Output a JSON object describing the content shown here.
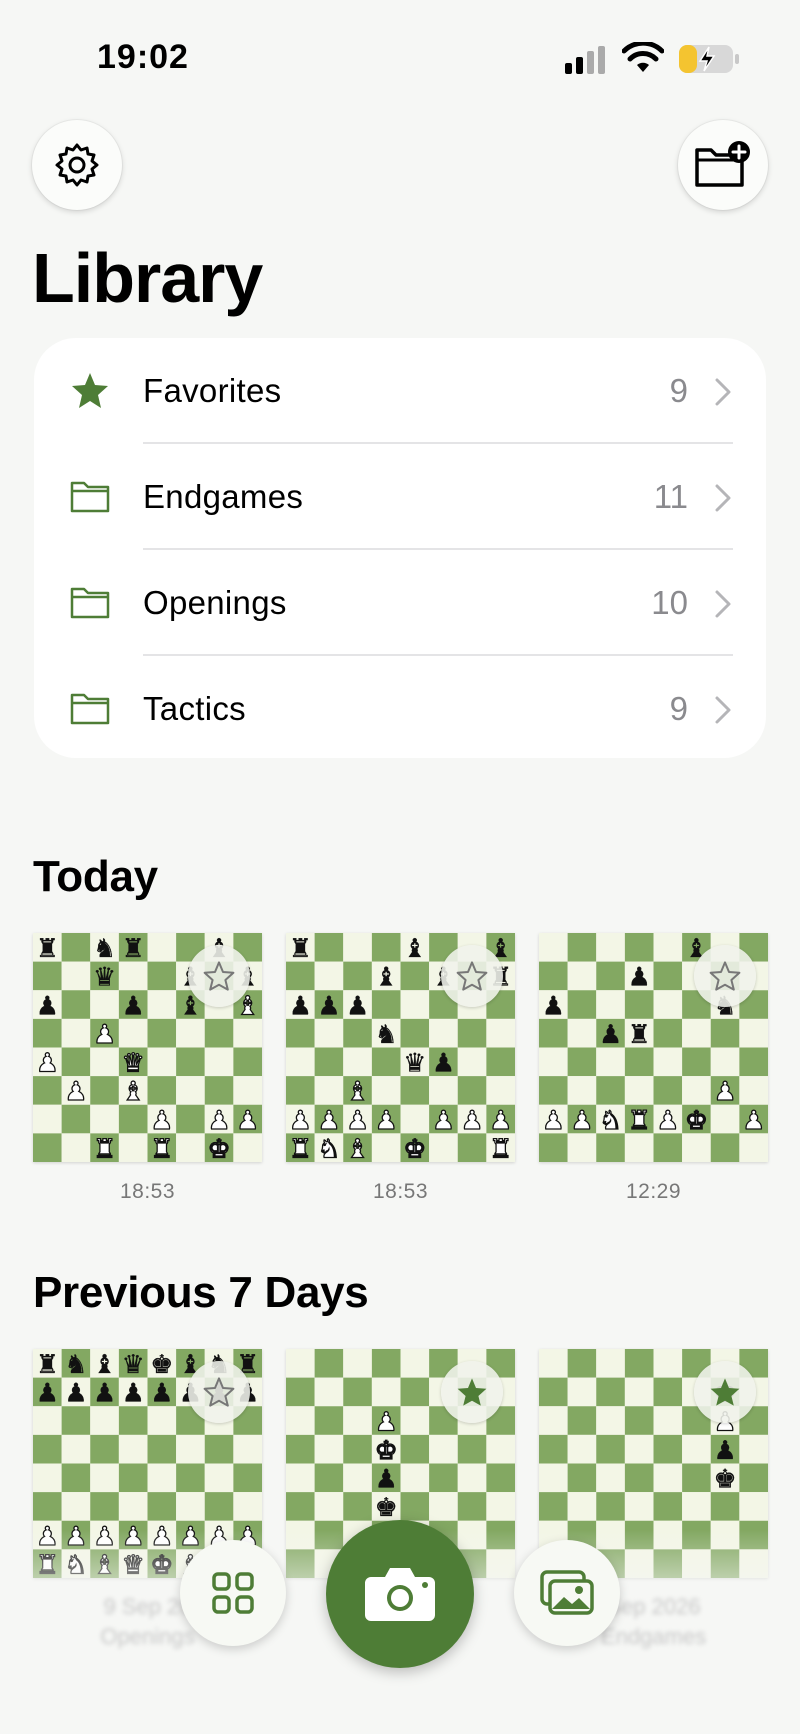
{
  "status": {
    "time": "19:02"
  },
  "title": "Library",
  "folders": [
    {
      "label": "Favorites",
      "count": "9",
      "icon": "star-filled-icon"
    },
    {
      "label": "Endgames",
      "count": "11",
      "icon": "folder-icon"
    },
    {
      "label": "Openings",
      "count": "10",
      "icon": "folder-icon"
    },
    {
      "label": "Tactics",
      "count": "9",
      "icon": "folder-icon"
    }
  ],
  "sections": {
    "today": {
      "title": "Today",
      "items": [
        {
          "time": "18:53",
          "favorite": false,
          "position": [
            "r.nr..b.",
            "..q..b.b",
            "p..p.b.B",
            "..P.....",
            "P..Q....",
            ".P.B....",
            "....P.PP",
            "..R.R.K."
          ]
        },
        {
          "time": "18:53",
          "favorite": false,
          "position": [
            "r...b..b",
            "...b.b.r",
            "ppp.....",
            "...n....",
            "....qp..",
            "..B.....",
            "PPPP.PPP",
            "RNB.K..R"
          ]
        },
        {
          "time": "12:29",
          "favorite": false,
          "position": [
            ".....b..",
            "...p....",
            "p.....n.",
            "..pr....",
            "........",
            "......P.",
            "PPNRPK.P",
            "........"
          ]
        }
      ]
    },
    "previous": {
      "title": "Previous 7 Days",
      "items": [
        {
          "time": "9 Sep 20",
          "caption": "Openings",
          "favorite": false,
          "position": [
            "rnbqkbnr",
            "pppppppp",
            "........",
            "........",
            "........",
            "........",
            "PPPPPPPP",
            "RNBQKBNR"
          ]
        },
        {
          "time": "",
          "caption": "",
          "favorite": true,
          "position": [
            "........",
            "........",
            "...P....",
            "...K....",
            "...p....",
            "...k....",
            "........",
            "........"
          ]
        },
        {
          "time": "Sep 2026",
          "caption": "Endgames",
          "favorite": true,
          "position": [
            "........",
            "......K.",
            "......P.",
            "......p.",
            "......k.",
            "........",
            "........",
            "........"
          ]
        }
      ]
    }
  },
  "colors": {
    "accent": "#4e7d36",
    "board_light": "#f3f6e6",
    "board_dark": "#83a862"
  }
}
